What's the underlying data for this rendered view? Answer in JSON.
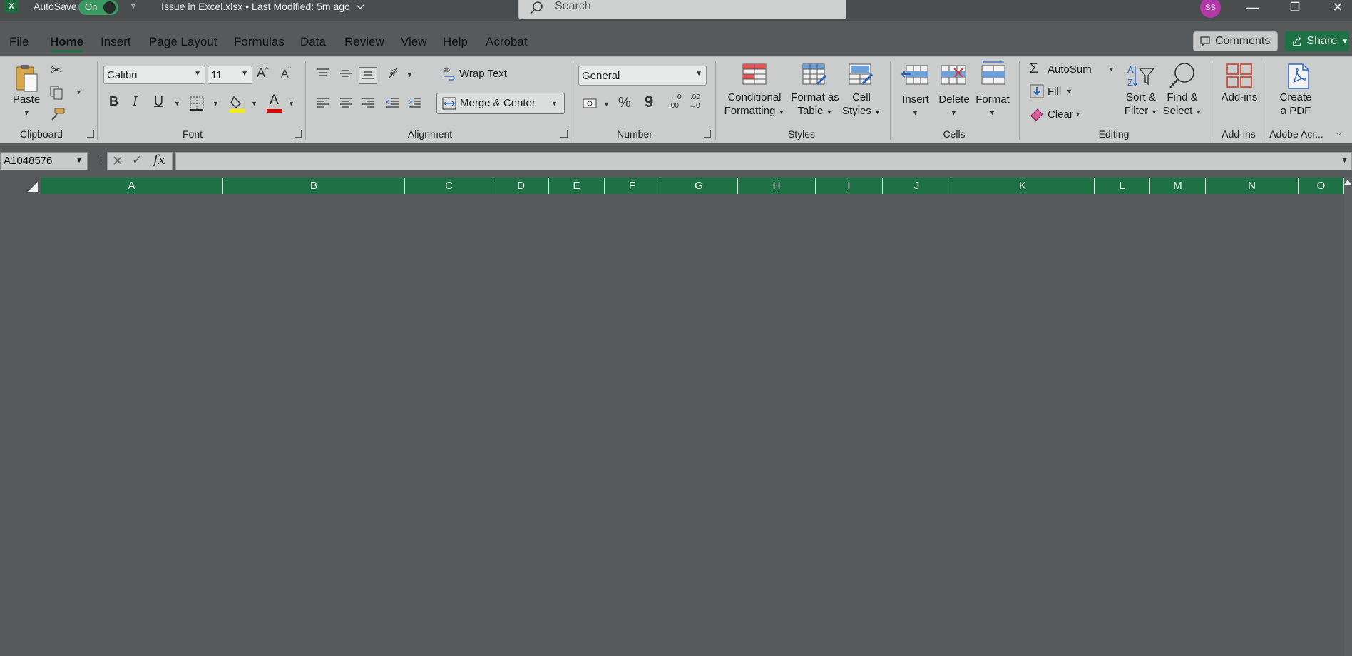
{
  "titlebar": {
    "app_logo": "X",
    "autosave_label": "AutoSave",
    "autosave_state": "On",
    "qat_more": "▿",
    "document_title": "Issue in Excel.xlsx  •  Last Modified: 5m ago",
    "search_placeholder": "Search",
    "avatar_initials": "SS",
    "minimize": "—",
    "restore": "❐",
    "close": "✕"
  },
  "tabs": [
    "File",
    "Home",
    "Insert",
    "Page Layout",
    "Formulas",
    "Data",
    "Review",
    "View",
    "Help",
    "Acrobat"
  ],
  "active_tab": "Home",
  "top_buttons": {
    "comments": "Comments",
    "share": "Share"
  },
  "ribbon": {
    "clipboard": {
      "group": "Clipboard",
      "paste": "Paste"
    },
    "font": {
      "group": "Font",
      "font_name": "Calibri",
      "font_size": "11",
      "bold": "B",
      "italic": "I",
      "underline": "U",
      "font_color_glyph": "A",
      "highlight_color": "#f5ec00",
      "font_color": "#e00000"
    },
    "alignment": {
      "group": "Alignment",
      "wrap_text": "Wrap Text",
      "merge_center": "Merge & Center"
    },
    "number": {
      "group": "Number",
      "format": "General",
      "percent": "%",
      "comma": "9",
      "increase_decimal": ".00",
      "decrease_decimal": ".00"
    },
    "styles": {
      "group": "Styles",
      "conditional_formatting": [
        "Conditional",
        "Formatting"
      ],
      "format_as_table": [
        "Format as",
        "Table"
      ],
      "cell_styles": [
        "Cell",
        "Styles"
      ]
    },
    "cells": {
      "group": "Cells",
      "insert": "Insert",
      "delete": "Delete",
      "format": "Format"
    },
    "editing": {
      "group": "Editing",
      "autosum": "AutoSum",
      "fill": "Fill",
      "clear": "Clear",
      "sort_filter": [
        "Sort &",
        "Filter"
      ],
      "find_select": [
        "Find &",
        "Select"
      ]
    },
    "addins": {
      "group": "Add-ins",
      "addins": "Add-ins"
    },
    "acrobat": {
      "group": "Adobe Acr...",
      "create_pdf": [
        "Create",
        "a PDF"
      ]
    }
  },
  "formula_bar": {
    "name_box": "A1048576",
    "dots": "⋮",
    "cancel": "✕",
    "enter": "✓",
    "fx": "fx",
    "formula": ""
  },
  "columns": [
    "A",
    "B",
    "C",
    "D",
    "E",
    "F",
    "G",
    "H",
    "I",
    "J",
    "K",
    "L",
    "M",
    "N",
    "O"
  ],
  "colors": {
    "excel_green": "#1e7145",
    "ribbon_bg": "#cbcdcd",
    "sheet_bg": "#565a5a"
  }
}
